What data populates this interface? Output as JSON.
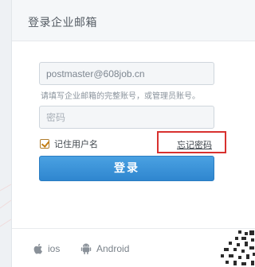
{
  "header": {
    "title": "登录企业邮箱"
  },
  "form": {
    "email_value": "postmaster@608job.cn",
    "email_hint": "请填写企业邮箱的完整账号，或管理员账号。",
    "password_placeholder": "密码",
    "remember_label": "记住用户名",
    "remember_checked": true,
    "forgot_label": "忘记密码",
    "login_label": "登录"
  },
  "apps": [
    {
      "label": "ios",
      "icon": "apple-icon"
    },
    {
      "label": "Android",
      "icon": "android-icon"
    }
  ],
  "colors": {
    "primary_button": "#3a92d8",
    "highlight_box": "#d8312f",
    "checkbox": "#c47d12"
  }
}
